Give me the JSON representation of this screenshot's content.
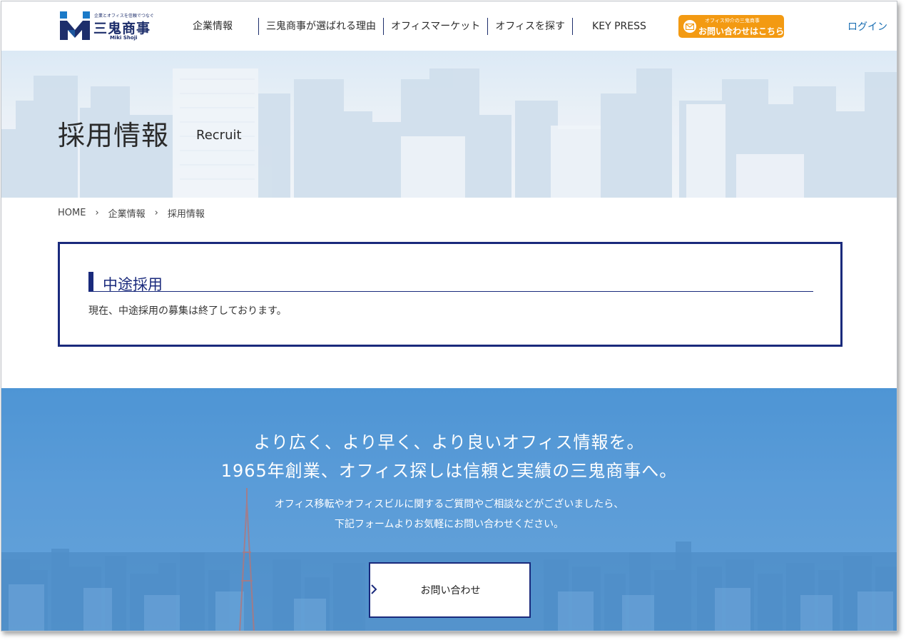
{
  "header": {
    "logo": {
      "tagline": "企業とオフィスを信頼でつなぐ",
      "name": "三鬼商事",
      "roman": "Miki Shoji"
    },
    "nav": [
      {
        "label": "企業情報"
      },
      {
        "label": "三鬼商事が選ばれる理由"
      },
      {
        "label": "オフィスマーケット"
      },
      {
        "label": "オフィスを探す"
      },
      {
        "label": "KEY PRESS"
      }
    ],
    "contact": {
      "small": "オフィス仲介の三鬼商事",
      "label": "お問い合わせはこちら",
      "icon": "mail-icon",
      "color": "#f39a12"
    },
    "login": "ログイン"
  },
  "hero": {
    "title": "採用情報",
    "subtitle": "Recruit"
  },
  "breadcrumb": [
    {
      "label": "HOME"
    },
    {
      "label": "企業情報"
    },
    {
      "label": "採用情報"
    }
  ],
  "section": {
    "heading": "中途採用",
    "text": "現在、中途採用の募集は終了しております。",
    "accent": "#1a2a7c"
  },
  "cta": {
    "headline1": "より広く、より早く、より良いオフィス情報を。",
    "headline2": "1965年創業、オフィス探しは信頼と実績の三鬼商事へ。",
    "body1": "オフィス移転やオフィスビルに関するご質問やご相談などがございましたら、",
    "body2": "下記フォームよりお気軽にお問い合わせください。",
    "button": "お問い合わせ"
  }
}
